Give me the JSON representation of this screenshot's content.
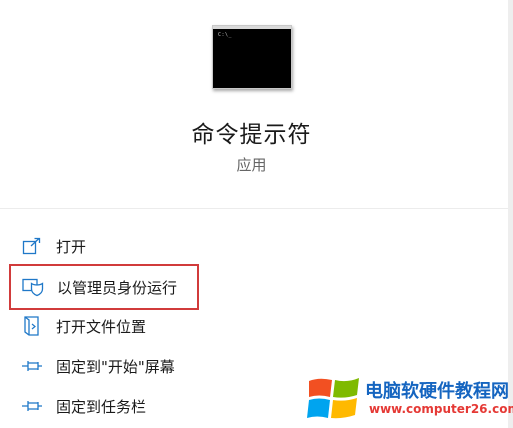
{
  "app": {
    "title": "命令提示符",
    "subtitle": "应用",
    "icon": "cmd-window-icon",
    "icon_prompt_text": "C:\\_"
  },
  "actions": [
    {
      "label": "打开",
      "icon": "open-icon",
      "highlighted": false
    },
    {
      "label": "以管理员身份运行",
      "icon": "shield-icon",
      "highlighted": true
    },
    {
      "label": "打开文件位置",
      "icon": "folder-icon",
      "highlighted": false
    },
    {
      "label": "固定到\"开始\"屏幕",
      "icon": "pin-icon",
      "highlighted": false
    },
    {
      "label": "固定到任务栏",
      "icon": "pin-icon",
      "highlighted": false
    }
  ],
  "watermark": {
    "title": "电脑软硬件教程网",
    "url": "www.computer26.com",
    "logo": "windows-logo-icon"
  },
  "colors": {
    "accent": "#1f78c8",
    "highlight_border": "#d13b3b",
    "watermark_title": "#1565c0",
    "watermark_url": "#e53935"
  }
}
